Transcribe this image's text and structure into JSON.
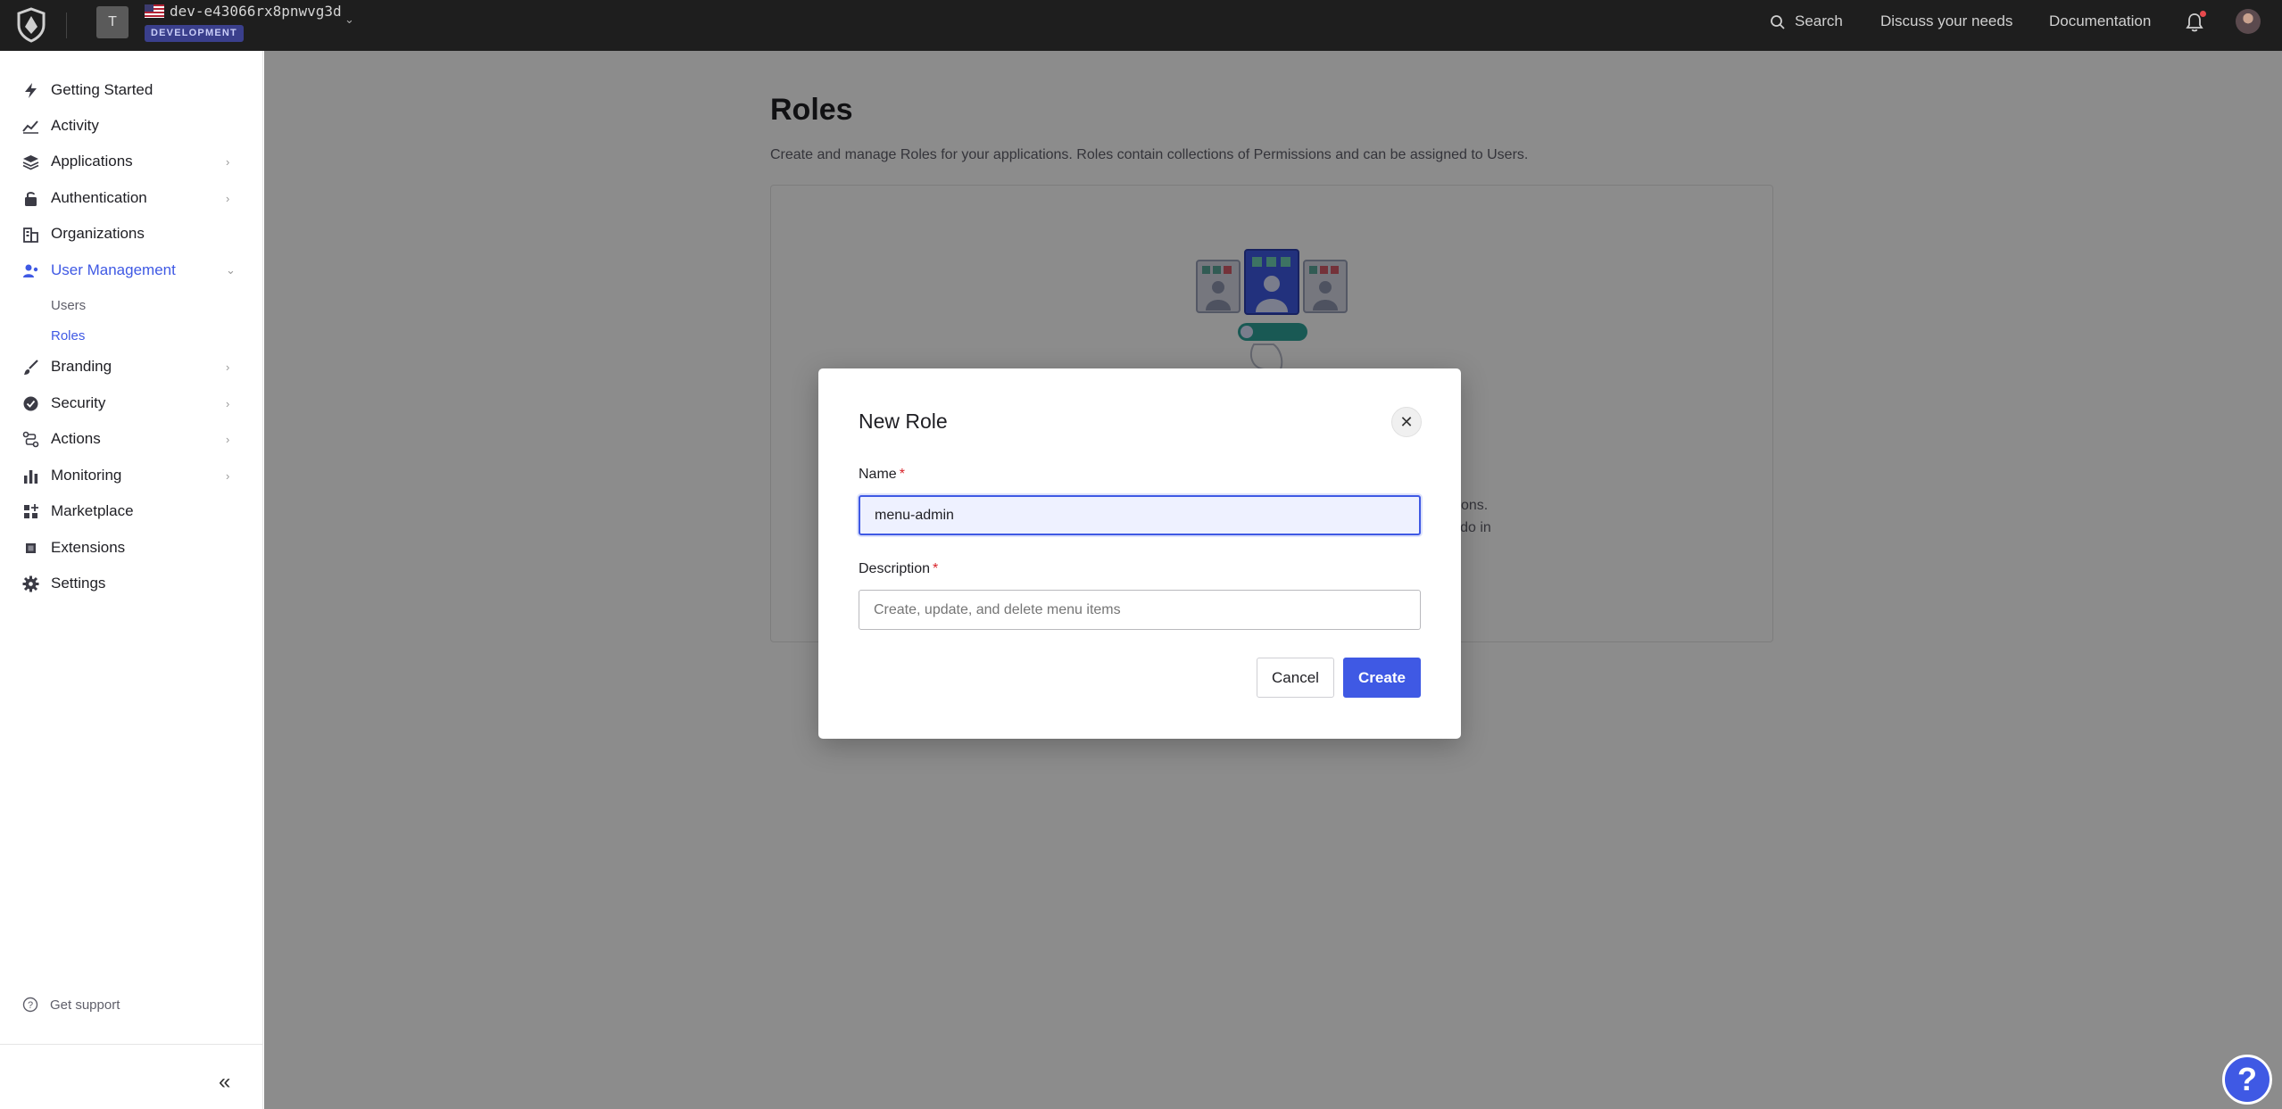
{
  "topbar": {
    "tenant_initial": "T",
    "tenant_name": "dev-e43066rx8pnwvg3d",
    "environment": "DEVELOPMENT",
    "search_label": "Search",
    "discuss_label": "Discuss your needs",
    "docs_label": "Documentation"
  },
  "sidebar": {
    "items": [
      {
        "label": "Getting Started",
        "icon": "bolt-icon"
      },
      {
        "label": "Activity",
        "icon": "activity-chart-icon"
      },
      {
        "label": "Applications",
        "icon": "layers-icon"
      },
      {
        "label": "Authentication",
        "icon": "lock-icon"
      },
      {
        "label": "Organizations",
        "icon": "building-icon"
      },
      {
        "label": "User Management",
        "icon": "users-icon"
      },
      {
        "label": "Branding",
        "icon": "brush-icon"
      },
      {
        "label": "Security",
        "icon": "shield-check-icon"
      },
      {
        "label": "Actions",
        "icon": "flow-icon"
      },
      {
        "label": "Monitoring",
        "icon": "bar-chart-icon"
      },
      {
        "label": "Marketplace",
        "icon": "grid-plus-icon"
      },
      {
        "label": "Extensions",
        "icon": "puzzle-icon"
      },
      {
        "label": "Settings",
        "icon": "gear-icon"
      }
    ],
    "sub_items": {
      "users": "Users",
      "roles": "Roles"
    },
    "support_label": "Get support"
  },
  "page": {
    "title": "Roles",
    "description": "Create and manage Roles for your applications. Roles contain collections of Permissions and can be assigned to Users.",
    "partial_text_1": "lications.",
    "partial_text_2": "d to do in"
  },
  "modal": {
    "title": "New Role",
    "name_label": "Name",
    "name_value": "menu-admin",
    "description_label": "Description",
    "description_placeholder": "Create, update, and delete menu items",
    "cancel_label": "Cancel",
    "create_label": "Create"
  },
  "colors": {
    "accent": "#3f59e4",
    "topbar_bg": "#1e1e1e",
    "required": "#d8232a"
  }
}
